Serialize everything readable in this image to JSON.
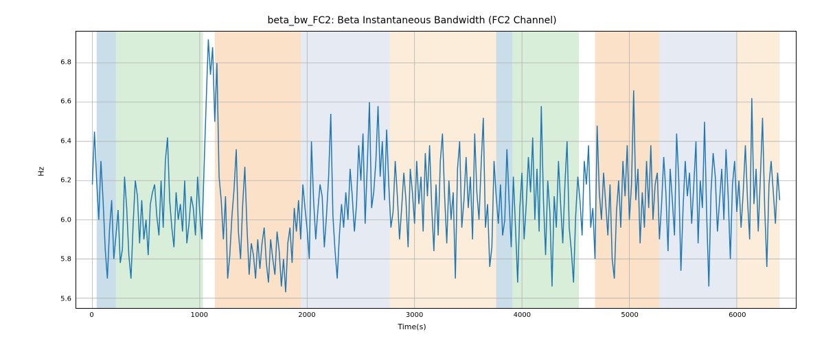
{
  "chart_data": {
    "type": "line",
    "title": "beta_bw_FC2: Beta Instantaneous Bandwidth (FC2 Channel)",
    "xlabel": "Time(s)",
    "ylabel": "Hz",
    "xlim": [
      -150,
      6550
    ],
    "ylim": [
      5.55,
      6.96
    ],
    "xticks": [
      0,
      1000,
      2000,
      3000,
      4000,
      5000,
      6000
    ],
    "yticks": [
      5.6,
      5.8,
      6.0,
      6.2,
      6.4,
      6.6,
      6.8
    ],
    "bands": [
      {
        "x0": 40,
        "x1": 220,
        "color": "#9fc2d9",
        "alpha": 0.55
      },
      {
        "x0": 220,
        "x1": 1030,
        "color": "#b8e0b8",
        "alpha": 0.55
      },
      {
        "x0": 1140,
        "x1": 1940,
        "color": "#f6c89b",
        "alpha": 0.55
      },
      {
        "x0": 1940,
        "x1": 2770,
        "color": "#cfd9ea",
        "alpha": 0.55
      },
      {
        "x0": 2770,
        "x1": 3760,
        "color": "#f8deba",
        "alpha": 0.55
      },
      {
        "x0": 3760,
        "x1": 3910,
        "color": "#9fc2d9",
        "alpha": 0.55
      },
      {
        "x0": 3910,
        "x1": 4530,
        "color": "#b8e0b8",
        "alpha": 0.55
      },
      {
        "x0": 4680,
        "x1": 5280,
        "color": "#f6c89b",
        "alpha": 0.55
      },
      {
        "x0": 5280,
        "x1": 6000,
        "color": "#cfd9ea",
        "alpha": 0.55
      },
      {
        "x0": 6000,
        "x1": 6400,
        "color": "#f8deba",
        "alpha": 0.55
      }
    ],
    "x_start": 0,
    "x_step": 20,
    "series": [
      {
        "name": "beta_bw_FC2",
        "color": "#1f77b4",
        "values": [
          6.18,
          6.45,
          6.2,
          6.0,
          6.3,
          6.1,
          5.85,
          5.7,
          5.95,
          6.1,
          5.8,
          5.92,
          6.05,
          5.78,
          5.85,
          6.22,
          6.06,
          5.82,
          5.7,
          5.98,
          6.2,
          6.12,
          5.88,
          6.1,
          5.9,
          6.0,
          5.82,
          6.08,
          6.14,
          6.18,
          6.02,
          5.92,
          6.2,
          5.96,
          6.3,
          6.42,
          6.1,
          5.96,
          5.86,
          6.14,
          6.0,
          6.08,
          5.94,
          6.2,
          5.88,
          5.98,
          6.12,
          6.06,
          5.92,
          6.22,
          6.04,
          5.9,
          6.26,
          6.6,
          6.92,
          6.74,
          6.88,
          6.5,
          6.8,
          6.22,
          6.1,
          5.9,
          6.12,
          5.7,
          5.82,
          6.02,
          6.16,
          6.36,
          5.94,
          5.8,
          6.08,
          6.27,
          5.96,
          5.72,
          5.88,
          5.82,
          5.7,
          5.9,
          5.75,
          5.88,
          5.96,
          5.78,
          5.68,
          5.9,
          5.8,
          5.72,
          5.94,
          5.84,
          5.66,
          5.8,
          5.63,
          5.88,
          5.96,
          5.78,
          6.06,
          5.94,
          6.1,
          5.9,
          6.18,
          6.06,
          5.95,
          5.8,
          6.4,
          6.1,
          5.9,
          6.05,
          6.18,
          6.12,
          5.86,
          6.02,
          6.22,
          6.54,
          6.02,
          5.84,
          5.7,
          5.92,
          6.08,
          5.96,
          6.14,
          6.0,
          6.26,
          6.12,
          5.94,
          6.08,
          6.38,
          6.2,
          6.44,
          5.98,
          6.28,
          6.6,
          6.06,
          6.14,
          6.3,
          6.58,
          6.22,
          6.4,
          6.1,
          6.46,
          6.18,
          5.96,
          6.04,
          6.3,
          6.12,
          5.9,
          6.06,
          6.24,
          6.1,
          5.86,
          6.26,
          6.14,
          5.98,
          6.3,
          6.08,
          6.22,
          5.94,
          6.34,
          6.12,
          6.38,
          6.06,
          5.84,
          6.18,
          5.92,
          6.3,
          6.44,
          6.12,
          5.88,
          6.2,
          6.0,
          6.14,
          5.7,
          6.26,
          6.4,
          5.96,
          6.1,
          6.32,
          6.06,
          6.22,
          5.9,
          6.44,
          6.14,
          6.0,
          6.28,
          6.52,
          5.96,
          6.08,
          5.76,
          5.86,
          6.3,
          6.12,
          5.98,
          6.18,
          5.92,
          6.0,
          6.36,
          6.1,
          5.86,
          6.22,
          5.96,
          5.68,
          6.06,
          6.24,
          5.9,
          6.08,
          6.32,
          6.14,
          6.42,
          6.0,
          6.26,
          5.94,
          6.58,
          6.1,
          5.82,
          6.2,
          6.04,
          5.66,
          6.12,
          5.96,
          6.3,
          6.08,
          5.88,
          6.18,
          6.4,
          5.96,
          5.84,
          5.68,
          6.02,
          6.22,
          6.1,
          5.92,
          6.3,
          6.18,
          6.38,
          5.96,
          6.06,
          5.8,
          6.48,
          6.14,
          6.0,
          6.24,
          6.08,
          5.92,
          6.18,
          5.8,
          5.7,
          6.04,
          6.2,
          5.96,
          6.3,
          6.12,
          6.38,
          6.0,
          6.18,
          6.66,
          6.1,
          6.26,
          5.88,
          6.14,
          5.96,
          6.3,
          6.06,
          6.38,
          6.0,
          6.18,
          6.24,
          5.9,
          6.08,
          6.32,
          6.14,
          5.84,
          6.26,
          6.1,
          5.92,
          6.44,
          6.2,
          5.74,
          6.06,
          6.3,
          6.12,
          6.24,
          5.98,
          6.18,
          6.4,
          5.88,
          6.2,
          6.06,
          6.5,
          6.02,
          5.66,
          6.14,
          6.34,
          6.22,
          5.94,
          6.1,
          6.26,
          6.0,
          6.36,
          6.12,
          5.8,
          6.18,
          6.3,
          6.04,
          6.2,
          5.96,
          6.14,
          6.38,
          6.1,
          5.9,
          6.62,
          6.08,
          6.26,
          5.94,
          6.22,
          6.52,
          6.06,
          5.76,
          6.18,
          6.3,
          6.14,
          5.98,
          6.24,
          6.1
        ]
      }
    ]
  }
}
